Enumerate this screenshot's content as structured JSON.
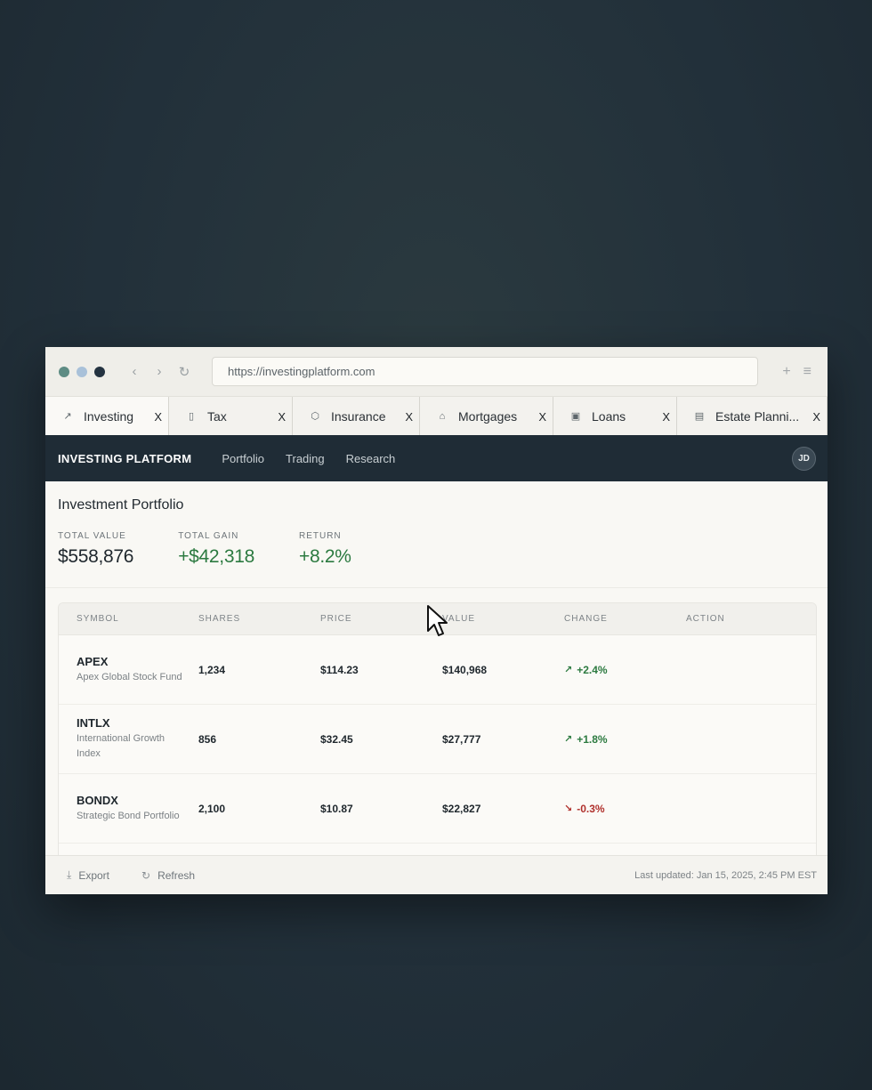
{
  "browser": {
    "url": "https://investingplatform.com",
    "window_dot_colors": [
      "#5e8c84",
      "#a9c1d9",
      "#243341"
    ],
    "nav_icons": [
      "back-icon",
      "forward-icon",
      "reload-icon"
    ],
    "right_icons": [
      "new-tab-icon",
      "menu-icon"
    ],
    "tabs": [
      {
        "label": "Investing",
        "icon": "trend-up-icon",
        "glyph": "↗",
        "close": "X"
      },
      {
        "label": "Tax",
        "icon": "calculator-icon",
        "glyph": "▯",
        "close": "X"
      },
      {
        "label": "Insurance",
        "icon": "shield-icon",
        "glyph": "⬡",
        "close": "X"
      },
      {
        "label": "Mortgages",
        "icon": "home-icon",
        "glyph": "⌂",
        "close": "X"
      },
      {
        "label": "Loans",
        "icon": "briefcase-icon",
        "glyph": "▣",
        "close": "X"
      },
      {
        "label": "Estate Planni...",
        "icon": "document-icon",
        "glyph": "▤",
        "close": "X"
      }
    ]
  },
  "app": {
    "brand": "INVESTING PLATFORM",
    "nav": [
      "Portfolio",
      "Trading",
      "Research"
    ],
    "avatar": "JD"
  },
  "portfolio": {
    "title": "Investment Portfolio",
    "stats": [
      {
        "label": "TOTAL VALUE",
        "value": "$558,876",
        "tone": "neutral"
      },
      {
        "label": "TOTAL GAIN",
        "value": "+$42,318",
        "tone": "positive"
      },
      {
        "label": "RETURN",
        "value": "+8.2%",
        "tone": "positive"
      }
    ]
  },
  "table": {
    "headers": [
      "SYMBOL",
      "SHARES",
      "PRICE",
      "VALUE",
      "CHANGE",
      "ACTION"
    ],
    "rows": [
      {
        "symbol": "APEX",
        "name": "Apex Global Stock Fund",
        "shares": "1,234",
        "price": "$114.23",
        "value": "$140,968",
        "change": "+2.4%",
        "direction": "up"
      },
      {
        "symbol": "INTLX",
        "name": "International Growth Index",
        "shares": "856",
        "price": "$32.45",
        "value": "$27,777",
        "change": "+1.8%",
        "direction": "up"
      },
      {
        "symbol": "BONDX",
        "name": "Strategic Bond Portfolio",
        "shares": "2,100",
        "price": "$10.87",
        "value": "$22,827",
        "change": "-0.3%",
        "direction": "down"
      }
    ]
  },
  "footer": {
    "export_label": "Export",
    "refresh_label": "Refresh",
    "last_updated": "Last updated: Jan 15, 2025, 2:45 PM EST"
  },
  "colors": {
    "positive": "#2c7a40",
    "negative": "#b0302c",
    "appbar": "#1f2c36"
  }
}
